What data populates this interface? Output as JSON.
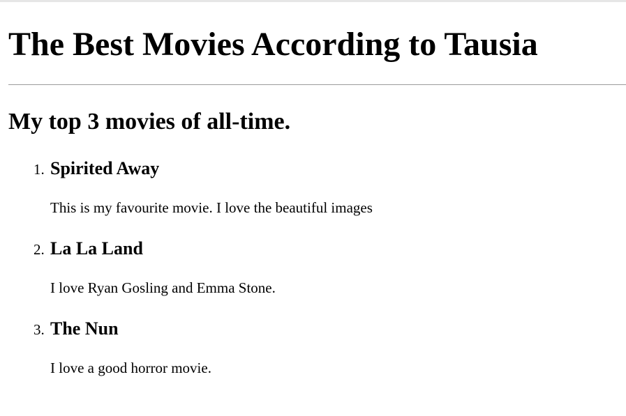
{
  "page": {
    "title": "The Best Movies According to Tausia",
    "subtitle": "My top 3 movies of all-time."
  },
  "movies": [
    {
      "number": "1.",
      "title": "Spirited Away",
      "description": "This is my favourite movie. I love the beautiful images"
    },
    {
      "number": "2.",
      "title": "La La Land",
      "description": "I love Ryan Gosling and Emma Stone."
    },
    {
      "number": "3.",
      "title": "The Nun",
      "description": "I love a good horror movie."
    }
  ]
}
